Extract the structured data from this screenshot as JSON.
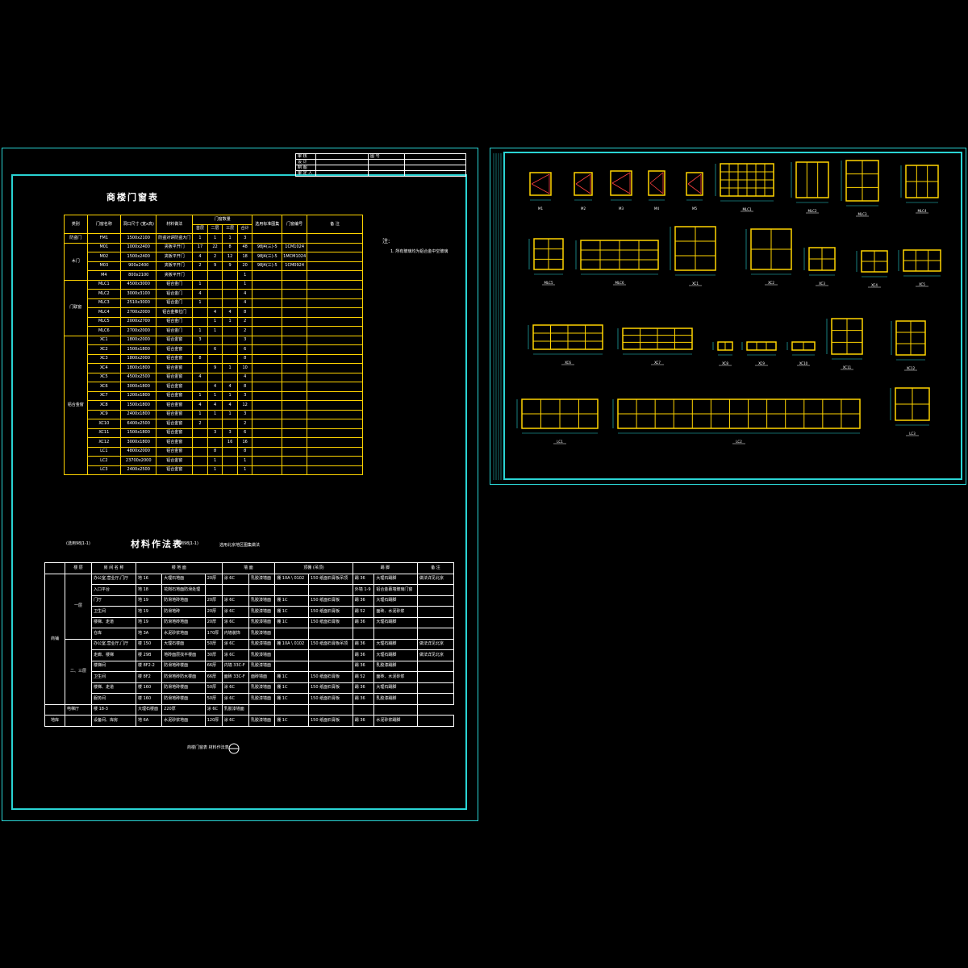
{
  "title_block": {
    "rows": [
      "审 核",
      "设 计",
      "制 图",
      "审 定 人"
    ],
    "header": "图 号"
  },
  "door_table": {
    "title": "商楼门窗表",
    "headers": [
      "类别",
      "门窗名称",
      "洞口尺寸 (宽x高)",
      "材料做法",
      "门窗数量",
      "选用标准图集",
      "门窗编号",
      "备 注"
    ],
    "qty_headers": [
      "首层",
      "二层",
      "三层",
      "合计"
    ],
    "rows": [
      {
        "cat": "防盗门",
        "name": "FM1",
        "size": "1500x2100",
        "mat": "防盗对讲防盗大门",
        "q1": "1",
        "q2": "1",
        "q3": "1",
        "qt": "3",
        "std": "",
        "code": "",
        "note": ""
      },
      {
        "cat": "木门",
        "name": "M01",
        "size": "1000x2400",
        "mat": "夹板平开门",
        "q1": "17",
        "q2": "22",
        "q3": "8",
        "qt": "48",
        "std": "98J4(三)-5",
        "code": "1CM1024",
        "note": ""
      },
      {
        "cat": "",
        "name": "M02",
        "size": "1500x2400",
        "mat": "夹板平开门",
        "q1": "4",
        "q2": "2",
        "q3": "12",
        "qt": "18",
        "std": "98J4(三)-5",
        "code": "1MCM1024",
        "note": ""
      },
      {
        "cat": "",
        "name": "M03",
        "size": "900x2400",
        "mat": "夹板平开门",
        "q1": "2",
        "q2": "9",
        "q3": "9",
        "qt": "20",
        "std": "98J4(三)-5",
        "code": "1CM0924",
        "note": ""
      },
      {
        "cat": "",
        "name": "M4",
        "size": "800x2100",
        "mat": "夹板平开门",
        "q1": "",
        "q2": "",
        "q3": "",
        "qt": "1",
        "std": "",
        "code": "",
        "note": ""
      },
      {
        "cat": "门联窗",
        "name": "MLC1",
        "size": "4500x3000",
        "mat": "铝合金门",
        "q1": "1",
        "q2": "",
        "q3": "",
        "qt": "1",
        "std": "",
        "code": "",
        "note": ""
      },
      {
        "cat": "",
        "name": "MLC2",
        "size": "3000x3100",
        "mat": "铝合金门",
        "q1": "4",
        "q2": "",
        "q3": "",
        "qt": "4",
        "std": "",
        "code": "",
        "note": ""
      },
      {
        "cat": "",
        "name": "MLC3",
        "size": "2510x3000",
        "mat": "铝合金门",
        "q1": "1",
        "q2": "",
        "q3": "",
        "qt": "4",
        "std": "",
        "code": "",
        "note": ""
      },
      {
        "cat": "",
        "name": "MLC4",
        "size": "2700x2000",
        "mat": "铝合金推拉门",
        "q1": "",
        "q2": "4",
        "q3": "4",
        "qt": "8",
        "std": "",
        "code": "",
        "note": ""
      },
      {
        "cat": "",
        "name": "MLC5",
        "size": "2000x2700",
        "mat": "铝合金门",
        "q1": "",
        "q2": "1",
        "q3": "1",
        "qt": "2",
        "std": "",
        "code": "",
        "note": ""
      },
      {
        "cat": "",
        "name": "MLC6",
        "size": "2700x2000",
        "mat": "铝合金门",
        "q1": "1",
        "q2": "1",
        "q3": "",
        "qt": "2",
        "std": "",
        "code": "",
        "note": ""
      },
      {
        "cat": "铝合金窗",
        "name": "XC1",
        "size": "1800x2000",
        "mat": "铝合金窗",
        "q1": "3",
        "q2": "",
        "q3": "",
        "qt": "3",
        "std": "",
        "code": "",
        "note": ""
      },
      {
        "cat": "",
        "name": "XC2",
        "size": "1500x1800",
        "mat": "铝合金窗",
        "q1": "",
        "q2": "6",
        "q3": "",
        "qt": "6",
        "std": "",
        "code": "",
        "note": ""
      },
      {
        "cat": "",
        "name": "XC3",
        "size": "1800x2000",
        "mat": "铝合金窗",
        "q1": "8",
        "q2": "",
        "q3": "",
        "qt": "8",
        "std": "",
        "code": "",
        "note": ""
      },
      {
        "cat": "",
        "name": "XC4",
        "size": "1800x1800",
        "mat": "铝合金窗",
        "q1": "",
        "q2": "9",
        "q3": "1",
        "qt": "10",
        "std": "",
        "code": "",
        "note": ""
      },
      {
        "cat": "",
        "name": "XC5",
        "size": "4500x2500",
        "mat": "铝合金窗",
        "q1": "4",
        "q2": "",
        "q3": "",
        "qt": "4",
        "std": "",
        "code": "",
        "note": ""
      },
      {
        "cat": "",
        "name": "XC6",
        "size": "3000x1800",
        "mat": "铝合金窗",
        "q1": "",
        "q2": "4",
        "q3": "4",
        "qt": "8",
        "std": "",
        "code": "",
        "note": ""
      },
      {
        "cat": "",
        "name": "XC7",
        "size": "1200x1800",
        "mat": "铝合金窗",
        "q1": "1",
        "q2": "1",
        "q3": "1",
        "qt": "3",
        "std": "",
        "code": "",
        "note": ""
      },
      {
        "cat": "",
        "name": "XC8",
        "size": "1500x1800",
        "mat": "铝合金窗",
        "q1": "4",
        "q2": "4",
        "q3": "4",
        "qt": "12",
        "std": "",
        "code": "",
        "note": ""
      },
      {
        "cat": "",
        "name": "XC9",
        "size": "2400x1800",
        "mat": "铝合金窗",
        "q1": "1",
        "q2": "1",
        "q3": "1",
        "qt": "3",
        "std": "",
        "code": "",
        "note": ""
      },
      {
        "cat": "",
        "name": "XC10",
        "size": "6400x2500",
        "mat": "铝合金窗",
        "q1": "2",
        "q2": "",
        "q3": "",
        "qt": "2",
        "std": "",
        "code": "",
        "note": ""
      },
      {
        "cat": "",
        "name": "XC11",
        "size": "1500x1800",
        "mat": "铝合金窗",
        "q1": "",
        "q2": "3",
        "q3": "3",
        "qt": "6",
        "std": "",
        "code": "",
        "note": ""
      },
      {
        "cat": "",
        "name": "XC12",
        "size": "3000x1800",
        "mat": "铝合金窗",
        "q1": "",
        "q2": "",
        "q3": "16",
        "qt": "16",
        "std": "",
        "code": "",
        "note": ""
      },
      {
        "cat": "",
        "name": "LC1",
        "size": "4800x2000",
        "mat": "铝合金窗",
        "q1": "",
        "q2": "8",
        "q3": "",
        "qt": "8",
        "std": "",
        "code": "",
        "note": ""
      },
      {
        "cat": "",
        "name": "LC2",
        "size": "23700x2000",
        "mat": "铝合金窗",
        "q1": "",
        "q2": "1",
        "q3": "",
        "qt": "1",
        "std": "",
        "code": "",
        "note": ""
      },
      {
        "cat": "",
        "name": "LC3",
        "size": "2400x2500",
        "mat": "铝合金窗",
        "q1": "",
        "q2": "1",
        "q3": "",
        "qt": "1",
        "std": "",
        "code": "",
        "note": ""
      }
    ]
  },
  "note": {
    "label": "注:",
    "text": "1. 所有玻璃均为铝合金中空玻璃"
  },
  "material_table": {
    "title": "材料作法表",
    "left_note": "(选用98J1-1)",
    "sub_note": "(选用98J1-1)",
    "right_note": "选用北京地区图集做法",
    "headers": [
      "",
      "楼 层",
      "房 间 名 称",
      "楼 地 面",
      "",
      "墙 面",
      "",
      "顶棚 (吊顶)",
      "",
      "踢 脚",
      "备 注"
    ],
    "group1": "商铺",
    "group2": "一层",
    "group3": "二、三层",
    "group4": "地库",
    "rows": [
      {
        "room": "办公室,营业厅,门厅",
        "floor": "地 16",
        "floor2": "大理石地面",
        "fth": "20厚",
        "wall": "涂 6C",
        "wall2": "乳胶漆墙面",
        "ceil": "棚 10A \\ 0102",
        "ceil2": "150 纸面石膏板吊顶",
        "skirt": "踢 36",
        "skirt2": "大理石踢脚",
        "note": "做法详见北京"
      },
      {
        "room": "入口平台",
        "floor": "地 18",
        "floor2": "花岗石地面防滑处理",
        "fth": "",
        "wall": "",
        "wall2": "",
        "ceil": "",
        "ceil2": "",
        "skirt": "外墙 1-9",
        "skirt2": "铝合金幕墙玻璃门窗",
        "note": ""
      },
      {
        "room": "门厅",
        "floor": "地 19",
        "floor2": "防滑地砖地面",
        "fth": "20厚",
        "wall": "涂 6C",
        "wall2": "乳胶漆墙面",
        "ceil": "棚 1C",
        "ceil2": "150 纸面石膏板",
        "skirt": "踢 36",
        "skirt2": "大理石踢脚",
        "note": ""
      },
      {
        "room": "卫生间",
        "floor": "地 19",
        "floor2": "防滑地砖",
        "fth": "20厚",
        "wall": "涂 6C",
        "wall2": "乳胶漆墙面",
        "ceil": "棚 1C",
        "ceil2": "150 纸面石膏板",
        "skirt": "踢 52",
        "skirt2": "面砖、水泥砂浆",
        "note": ""
      },
      {
        "room": "楼梯、走道",
        "floor": "地 19",
        "floor2": "防滑地砖地面",
        "fth": "20厚",
        "wall": "涂 6C",
        "wall2": "乳胶漆墙面",
        "ceil": "棚 1C",
        "ceil2": "150 纸面石膏板",
        "skirt": "踢 36",
        "skirt2": "大理石踢脚",
        "note": ""
      },
      {
        "room": "仓库",
        "floor": "地 3A",
        "floor2": "水泥砂浆地面",
        "fth": "170厚",
        "wall": "内墙装饰",
        "wall2": "乳胶漆墙面",
        "ceil": "",
        "ceil2": "",
        "skirt": "",
        "skirt2": "",
        "note": ""
      },
      {
        "room": "办公室,营业厅,门厅",
        "floor": "楼 150",
        "floor2": "大理石楼面",
        "fth": "50厚",
        "wall": "涂 6C",
        "wall2": "乳胶漆墙面",
        "ceil": "棚 10A \\ 0102",
        "ceil2": "150 纸面石膏板吊顶",
        "skirt": "踢 36",
        "skirt2": "大理石踢脚",
        "note": "做法详见北京"
      },
      {
        "room": "走廊、楼梯",
        "floor": "楼 29B",
        "floor2": "地砖面层找平楼面",
        "fth": "30厚",
        "wall": "涂 6C",
        "wall2": "乳胶漆墙面",
        "ceil": "",
        "ceil2": "",
        "skirt": "踢 36",
        "skirt2": "大理石踢脚",
        "note": "做法详见北京"
      },
      {
        "room": "楼梯间",
        "floor": "楼 8F2-2",
        "floor2": "防滑地砖楼面",
        "fth": "66厚",
        "wall": "内墙 33C-F",
        "wall2": "乳胶漆墙面",
        "ceil": "",
        "ceil2": "",
        "skirt": "踢 36",
        "skirt2": "乳胶漆踢脚",
        "note": ""
      },
      {
        "room": "卫生间",
        "floor": "楼 8F2",
        "floor2": "防滑地砖防水楼面",
        "fth": "66厚",
        "wall": "面砖 33C-F",
        "wall2": "面砖墙面",
        "ceil": "棚 1C",
        "ceil2": "150 纸面石膏板",
        "skirt": "踢 52",
        "skirt2": "面砖、水泥砂浆",
        "note": ""
      },
      {
        "room": "楼梯、走道",
        "floor": "楼 160",
        "floor2": "防滑地砖楼面",
        "fth": "50厚",
        "wall": "涂 6C",
        "wall2": "乳胶漆墙面",
        "ceil": "棚 1C",
        "ceil2": "150 纸面石膏板",
        "skirt": "踢 36",
        "skirt2": "大理石踢脚",
        "note": ""
      },
      {
        "room": "服务间",
        "floor": "楼 160",
        "floor2": "防滑地砖楼面",
        "fth": "50厚",
        "wall": "涂 6C",
        "wall2": "乳胶漆墙面",
        "ceil": "棚 1C",
        "ceil2": "150 纸面石膏板",
        "skirt": "踢 36",
        "skirt2": "乳胶漆踢脚",
        "note": ""
      },
      {
        "room": "电梯厅",
        "floor": "楼 18-3",
        "floor2": "大理石楼面",
        "fth": "220厚",
        "wall": "涂 6C",
        "wall2": "乳胶漆墙面",
        "ceil": "",
        "ceil2": "",
        "skirt": "",
        "skirt2": "",
        "note": ""
      },
      {
        "room": "设备间、库房",
        "floor": "地 6A",
        "floor2": "水泥砂浆地面",
        "fth": "120厚",
        "wall": "涂 6C",
        "wall2": "乳胶漆墙面",
        "ceil": "棚 1C",
        "ceil2": "150 纸面石膏板",
        "skirt": "踢 36",
        "skirt2": "水泥砂浆踢脚",
        "note": ""
      }
    ],
    "footer": "商楼门窗表 材料作法表"
  },
  "elevations": {
    "row1": [
      "M1",
      "M2",
      "M3",
      "M4",
      "M5",
      "MLC1",
      "MLC2",
      "MLC3",
      "MLC4"
    ],
    "row2": [
      "MLC5",
      "MLC6",
      "XC1",
      "XC2",
      "XC3",
      "XC4",
      "XC5"
    ],
    "row3": [
      "XC6",
      "XC7",
      "XC8",
      "XC9",
      "XC10",
      "XC11",
      "XC12"
    ],
    "row4": [
      "LC1",
      "LC2",
      "LC3"
    ]
  }
}
